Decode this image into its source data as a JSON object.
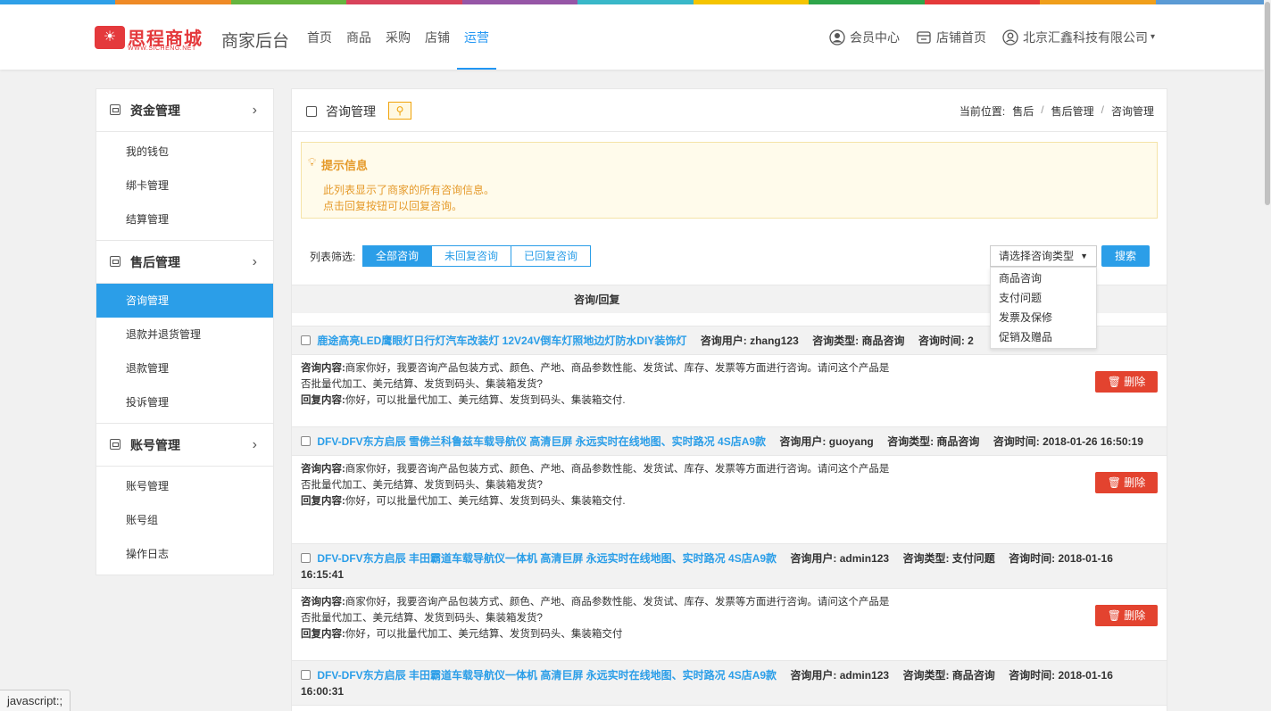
{
  "colors": {
    "stripe": [
      "#2fa0e8",
      "#ef8a26",
      "#66b53f",
      "#d9435b",
      "#9656a7",
      "#39b8c9",
      "#f5c400",
      "#2fa64a",
      "#e53a3a",
      "#f09f1b",
      "#5b9bd5"
    ],
    "primary": "#2b9ee8",
    "danger": "#e3432f",
    "tip_text": "#e59a2a"
  },
  "header": {
    "logo": {
      "name": "思程商城",
      "sub": "WWW.SICHENG.NET"
    },
    "app_title": "商家后台",
    "nav": [
      "首页",
      "商品",
      "采购",
      "店铺",
      "运营"
    ],
    "nav_active": "运营",
    "right": {
      "member_center": "会员中心",
      "shop_home": "店铺首页",
      "company": "北京汇鑫科技有限公司"
    }
  },
  "sidebar": {
    "groups": [
      {
        "title": "资金管理",
        "items": [
          "我的钱包",
          "绑卡管理",
          "结算管理"
        ]
      },
      {
        "title": "售后管理",
        "items": [
          "咨询管理",
          "退款并退货管理",
          "退款管理",
          "投诉管理"
        ]
      },
      {
        "title": "账号管理",
        "items": [
          "账号管理",
          "账号组",
          "操作日志"
        ]
      }
    ],
    "active_item": "咨询管理"
  },
  "main": {
    "title": "咨询管理",
    "breadcrumb": {
      "label": "当前位置:",
      "items": [
        "售后",
        "售后管理",
        "咨询管理"
      ]
    },
    "tip": {
      "title": "提示信息",
      "lines": [
        "此列表显示了商家的所有咨询信息。",
        "点击回复按钮可以回复咨询。"
      ]
    },
    "filter": {
      "label": "列表筛选:",
      "tabs": [
        "全部咨询",
        "未回复咨询",
        "已回复咨询"
      ],
      "active_tab": "全部咨询",
      "select_placeholder": "请选择咨询类型",
      "options": [
        "商品咨询",
        "支付问题",
        "发票及保修",
        "促销及赠品"
      ],
      "search": "搜索"
    },
    "table_header": "咨询/回复",
    "labels": {
      "user": "咨询用户:",
      "type": "咨询类型:",
      "time": "咨询时间:",
      "content": "咨询内容:",
      "reply": "回复内容:",
      "delete": "删除"
    },
    "records": [
      {
        "product": "鹿途高亮LED鹰眼灯日行灯汽车改装灯 12V24V倒车灯照地边灯防水DIY装饰灯",
        "user": "zhang123",
        "type": "商品咨询",
        "time": "2",
        "content": "商家你好，我要咨询产品包装方式、颜色、产地、商品参数性能、发货试、库存、发票等方面进行咨询。请问这个产品是否批量代加工、美元结算、发货到码头、集装箱发货?",
        "reply": "你好，可以批量代加工、美元结算、发货到码头、集装箱交付."
      },
      {
        "product": "DFV-DFV东方启辰 雪佛兰科鲁兹车载导航仪 高清巨屏 永远实时在线地图、实时路况 4S店A9款",
        "user": "guoyang",
        "type": "商品咨询",
        "time": "2018-01-26 16:50:19",
        "content": "商家你好，我要咨询产品包装方式、颜色、产地、商品参数性能、发货试、库存、发票等方面进行咨询。请问这个产品是否批量代加工、美元结算、发货到码头、集装箱发货?",
        "reply": "你好，可以批量代加工、美元结算、发货到码头、集装箱交付."
      },
      {
        "product": "DFV-DFV东方启辰 丰田霸道车载导航仪一体机 高清巨屏 永远实时在线地图、实时路况 4S店A9款",
        "user": "admin123",
        "type": "支付问题",
        "time": "2018-01-16 16:15:41",
        "content": "商家你好，我要咨询产品包装方式、颜色、产地、商品参数性能、发货试、库存、发票等方面进行咨询。请问这个产品是否批量代加工、美元结算、发货到码头、集装箱发货?",
        "reply": "你好，可以批量代加工、美元结算、发货到码头、集装箱交付"
      },
      {
        "product": "DFV-DFV东方启辰 丰田霸道车载导航仪一体机 高清巨屏 永远实时在线地图、实时路况 4S店A9款",
        "user": "admin123",
        "type": "商品咨询",
        "time": "2018-01-16 16:00:31"
      }
    ]
  },
  "status_bar": "javascript:;"
}
